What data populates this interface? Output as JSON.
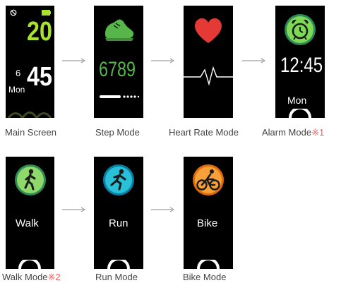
{
  "colors": {
    "accent_green": "#a6e22e",
    "heart_red": "#e53935",
    "step_green": "#57b649",
    "caption_mark": "#ff5a5a"
  },
  "row1": {
    "main": {
      "hours": "20",
      "minutes": "45",
      "day_number": "6",
      "day_name": "Mon",
      "caption": "Main Screen",
      "icons": [
        "alarm-off-icon",
        "battery-icon"
      ]
    },
    "step": {
      "value": "6789",
      "caption": "Step Mode",
      "icon": "shoe-icon"
    },
    "heart": {
      "caption": "Heart Rate Mode",
      "icons": [
        "heart-icon",
        "heartbeat-line-icon"
      ]
    },
    "alarm": {
      "time": "12:45",
      "day": "Mon",
      "caption": "Alarm Mode",
      "note_mark": "※1",
      "icon": "alarm-clock-icon"
    }
  },
  "row2": {
    "walk": {
      "label": "Walk",
      "caption": "Walk Mode",
      "note_mark": "※2",
      "icon": "walking-person-icon"
    },
    "run": {
      "label": "Run",
      "caption": "Run Mode",
      "icon": "running-person-icon"
    },
    "bike": {
      "label": "Bike",
      "caption": "Bike Mode",
      "icon": "cyclist-icon"
    }
  }
}
